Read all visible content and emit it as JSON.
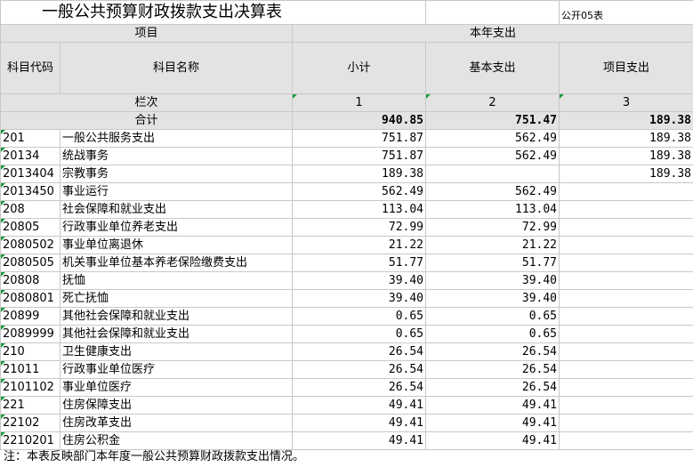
{
  "title": "一般公共预算财政拨款支出决算表",
  "table_tag": "公开05表",
  "headers": {
    "item": "项目",
    "current_year": "本年支出",
    "code": "科目代码",
    "name": "科目名称",
    "subtotal": "小计",
    "basic": "基本支出",
    "project": "项目支出",
    "column_index": "栏次",
    "col1": "1",
    "col2": "2",
    "col3": "3"
  },
  "total": {
    "label": "合计",
    "subtotal": "940.85",
    "basic": "751.47",
    "project": "189.38"
  },
  "rows": [
    {
      "code": "201",
      "name": "一般公共服务支出",
      "subtotal": "751.87",
      "basic": "562.49",
      "project": "189.38"
    },
    {
      "code": "20134",
      "name": "统战事务",
      "subtotal": "751.87",
      "basic": "562.49",
      "project": "189.38"
    },
    {
      "code": "2013404",
      "name": "宗教事务",
      "subtotal": "189.38",
      "basic": "",
      "project": "189.38"
    },
    {
      "code": "2013450",
      "name": "事业运行",
      "subtotal": "562.49",
      "basic": "562.49",
      "project": ""
    },
    {
      "code": "208",
      "name": "社会保障和就业支出",
      "subtotal": "113.04",
      "basic": "113.04",
      "project": ""
    },
    {
      "code": "20805",
      "name": "行政事业单位养老支出",
      "subtotal": "72.99",
      "basic": "72.99",
      "project": ""
    },
    {
      "code": "2080502",
      "name": "事业单位离退休",
      "subtotal": "21.22",
      "basic": "21.22",
      "project": ""
    },
    {
      "code": "2080505",
      "name": "机关事业单位基本养老保险缴费支出",
      "subtotal": "51.77",
      "basic": "51.77",
      "project": ""
    },
    {
      "code": "20808",
      "name": "抚恤",
      "subtotal": "39.40",
      "basic": "39.40",
      "project": ""
    },
    {
      "code": "2080801",
      "name": "死亡抚恤",
      "subtotal": "39.40",
      "basic": "39.40",
      "project": ""
    },
    {
      "code": "20899",
      "name": "其他社会保障和就业支出",
      "subtotal": "0.65",
      "basic": "0.65",
      "project": ""
    },
    {
      "code": "2089999",
      "name": "其他社会保障和就业支出",
      "subtotal": "0.65",
      "basic": "0.65",
      "project": ""
    },
    {
      "code": "210",
      "name": "卫生健康支出",
      "subtotal": "26.54",
      "basic": "26.54",
      "project": ""
    },
    {
      "code": "21011",
      "name": "行政事业单位医疗",
      "subtotal": "26.54",
      "basic": "26.54",
      "project": ""
    },
    {
      "code": "2101102",
      "name": "事业单位医疗",
      "subtotal": "26.54",
      "basic": "26.54",
      "project": ""
    },
    {
      "code": "221",
      "name": "住房保障支出",
      "subtotal": "49.41",
      "basic": "49.41",
      "project": ""
    },
    {
      "code": "22102",
      "name": "住房改革支出",
      "subtotal": "49.41",
      "basic": "49.41",
      "project": ""
    },
    {
      "code": "2210201",
      "name": "住房公积金",
      "subtotal": "49.41",
      "basic": "49.41",
      "project": ""
    }
  ],
  "note": "注：本表反映部门本年度一般公共预算财政拨款支出情况。"
}
